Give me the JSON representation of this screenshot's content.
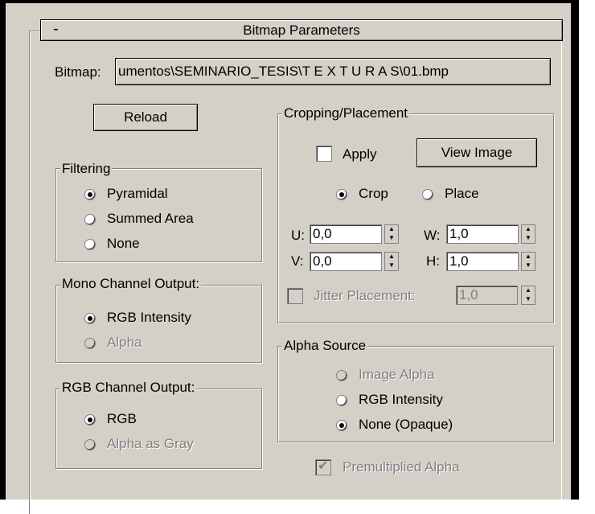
{
  "rollout": {
    "collapse_symbol": "-",
    "title": "Bitmap Parameters"
  },
  "bitmap": {
    "label": "Bitmap:",
    "path": "umentos\\SEMINARIO_TESIS\\T E X T U R A S\\01.bmp"
  },
  "reload_label": "Reload",
  "filtering": {
    "title": "Filtering",
    "options": [
      "Pyramidal",
      "Summed Area",
      "None"
    ],
    "selected": "Pyramidal"
  },
  "mono_output": {
    "title": "Mono Channel Output:",
    "options": [
      "RGB Intensity",
      "Alpha"
    ],
    "selected": "RGB Intensity"
  },
  "rgb_output": {
    "title": "RGB Channel Output:",
    "options": [
      "RGB",
      "Alpha as Gray"
    ],
    "selected": "RGB"
  },
  "cropping": {
    "title": "Cropping/Placement",
    "apply_label": "Apply",
    "apply_checked": false,
    "view_image_label": "View Image",
    "mode_options": [
      "Crop",
      "Place"
    ],
    "mode_selected": "Crop",
    "u_label": "U:",
    "u_value": "0,0",
    "v_label": "V:",
    "v_value": "0,0",
    "w_label": "W:",
    "w_value": "1,0",
    "h_label": "H:",
    "h_value": "1,0",
    "jitter_label": "Jitter Placement:",
    "jitter_value": "1,0"
  },
  "alpha_source": {
    "title": "Alpha Source",
    "options": [
      "Image Alpha",
      "RGB Intensity",
      "None (Opaque)"
    ],
    "selected": "None (Opaque)"
  },
  "premultiplied": {
    "label": "Premultiplied Alpha",
    "checked": true
  },
  "colors": {
    "panel": "#d4d0c8",
    "shadow": "#808080",
    "highlight": "#ffffff",
    "disabled_text": "#808080"
  },
  "icons": {
    "radio": "radio-button",
    "checkbox": "checkbox",
    "spinner": "up-down-arrows"
  }
}
